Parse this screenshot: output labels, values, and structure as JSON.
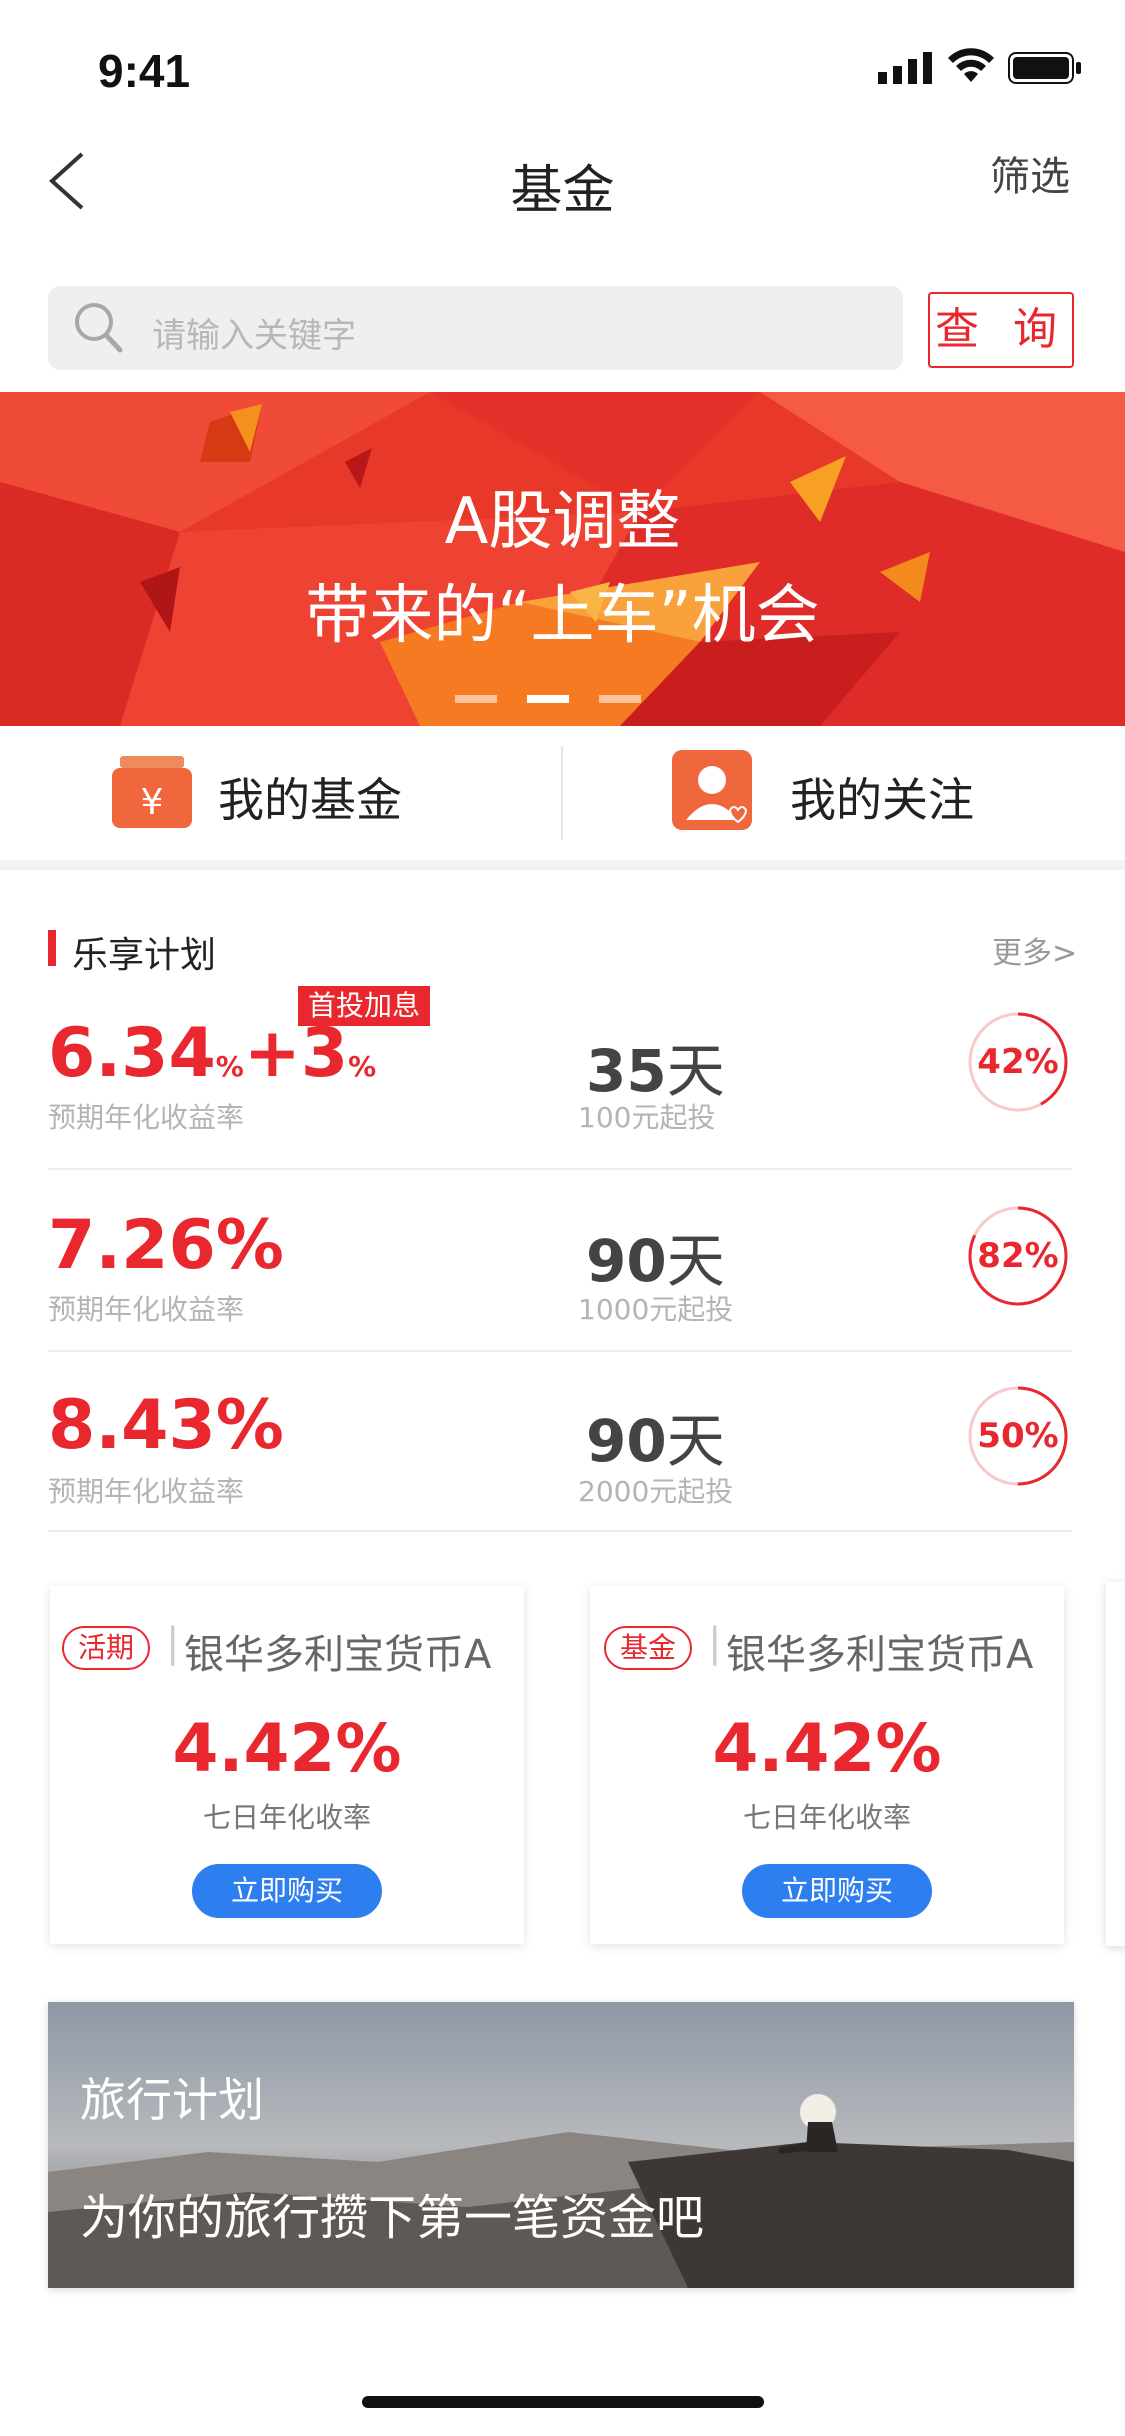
{
  "status_bar": {
    "time": "9:41"
  },
  "nav": {
    "title": "基金",
    "filter": "筛选"
  },
  "search": {
    "placeholder": "请输入关键字",
    "button": "查 询"
  },
  "banner": {
    "line1": "A股调整",
    "line2": "带来的“上车”机会",
    "pages": 3,
    "active_page": 2
  },
  "quick": {
    "my_fund": "我的基金",
    "my_follow": "我的关注"
  },
  "section": {
    "title": "乐享计划",
    "more": "更多>"
  },
  "plans": [
    {
      "rate_main": "6.34",
      "rate_unit": "%",
      "rate_bonus": "+3",
      "bonus_unit": "%",
      "badge": "首投加息",
      "rate_label": "预期年化收益率",
      "days": "35",
      "days_unit": "天",
      "min_invest": "100元起投",
      "progress_text": "42%",
      "progress": 0.42
    },
    {
      "rate_main": "7.26%",
      "rate_label": "预期年化收益率",
      "days": "90",
      "days_unit": "天",
      "min_invest": "1000元起投",
      "progress_text": "82%",
      "progress": 0.82
    },
    {
      "rate_main": "8.43%",
      "rate_label": "预期年化收益率",
      "days": "90",
      "days_unit": "天",
      "min_invest": "2000元起投",
      "progress_text": "50%",
      "progress": 0.5
    }
  ],
  "cards": [
    {
      "tag": "活期",
      "name": "银华多利宝货币A",
      "rate": "4.42%",
      "rate_label": "七日年化收率",
      "button": "立即购买"
    },
    {
      "tag": "基金",
      "name": "银华多利宝货币A",
      "rate": "4.42%",
      "rate_label": "七日年化收率",
      "button": "立即购买"
    }
  ],
  "travel": {
    "title": "旅行计划",
    "subtitle": "为你的旅行攒下第一笔资金吧"
  },
  "colors": {
    "accent": "#e8282e",
    "button_blue": "#2d7ff0",
    "banner": "#e8382a"
  }
}
